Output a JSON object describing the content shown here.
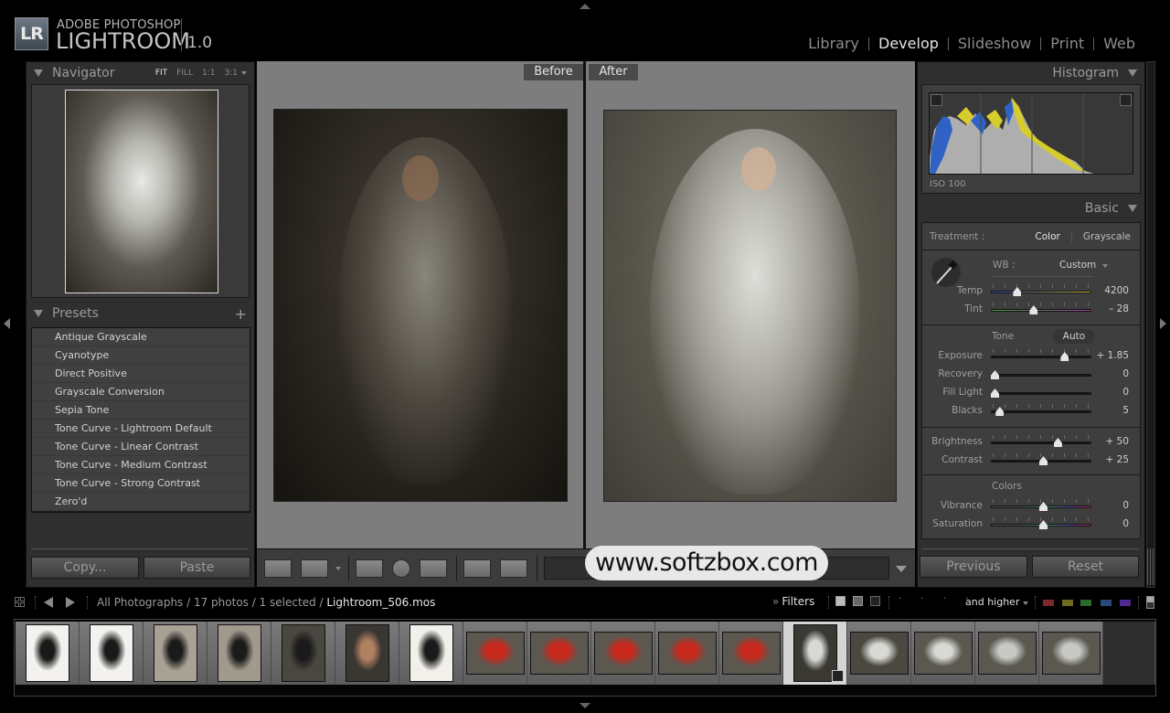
{
  "app": {
    "logo_badge": "LR",
    "vendor": "ADOBE PHOTOSHOP",
    "product": "LIGHTROOM",
    "version": "1.0"
  },
  "modules": [
    {
      "label": "Library",
      "active": false
    },
    {
      "label": "Develop",
      "active": true
    },
    {
      "label": "Slideshow",
      "active": false
    },
    {
      "label": "Print",
      "active": false
    },
    {
      "label": "Web",
      "active": false
    }
  ],
  "navigator": {
    "title": "Navigator",
    "zoom_options": [
      "FIT",
      "FILL",
      "1:1",
      "3:1"
    ],
    "zoom_selected": "FIT"
  },
  "presets": {
    "title": "Presets",
    "add_icon": "+",
    "items": [
      "Antique Grayscale",
      "Cyanotype",
      "Direct Positive",
      "Grayscale Conversion",
      "Sepia Tone",
      "Tone Curve - Lightroom Default",
      "Tone Curve - Linear Contrast",
      "Tone Curve - Medium Contrast",
      "Tone Curve - Strong Contrast",
      "Zero'd"
    ]
  },
  "left_buttons": {
    "copy": "Copy...",
    "paste": "Paste"
  },
  "view": {
    "before_label": "Before",
    "after_label": "After"
  },
  "toolbar": {
    "watermark": "www.softzbox.com",
    "icons": [
      "loupe-view-icon",
      "before-after-yy-icon",
      "crop-icon",
      "red-eye-icon",
      "spot-removal-icon",
      "copy-after-to-before-icon",
      "copy-before-to-after-icon"
    ]
  },
  "histogram": {
    "title": "Histogram",
    "iso": "ISO 100"
  },
  "basic": {
    "title": "Basic",
    "treatment_label": "Treatment :",
    "treatment_options": [
      "Color",
      "Grayscale"
    ],
    "treatment_selected": "Color",
    "wb_label": "WB :",
    "wb_value": "Custom",
    "wb_sliders": [
      {
        "label": "Temp",
        "value": "4200",
        "position": 0.23
      },
      {
        "label": "Tint",
        "value": "– 28",
        "position": 0.4
      }
    ],
    "tone_title": "Tone",
    "auto_label": "Auto",
    "tone_sliders": [
      {
        "label": "Exposure",
        "value": "+ 1.85",
        "position": 0.72
      },
      {
        "label": "Recovery",
        "value": "0",
        "position": 0.0
      },
      {
        "label": "Fill Light",
        "value": "0",
        "position": 0.0
      },
      {
        "label": "Blacks",
        "value": "5",
        "position": 0.05
      }
    ],
    "presence_sliders": [
      {
        "label": "Brightness",
        "value": "+ 50",
        "position": 0.65
      },
      {
        "label": "Contrast",
        "value": "+ 25",
        "position": 0.5
      }
    ],
    "colors_title": "Colors",
    "color_sliders": [
      {
        "label": "Vibrance",
        "value": "0",
        "position": 0.5
      },
      {
        "label": "Saturation",
        "value": "0",
        "position": 0.5
      }
    ]
  },
  "right_buttons": {
    "previous": "Previous",
    "reset": "Reset"
  },
  "filmstrip_bar": {
    "breadcrumb": "All Photographs / 17 photos / 1 selected / ",
    "filename": "Lightroom_506.mos",
    "filters_chevron": "»",
    "filters_label": "Filters",
    "rating_dots": "· · · · ·",
    "rating_filter": "and higher",
    "color_labels": [
      "#7a2a2a",
      "#6e6a1e",
      "#2a6a2a",
      "#2a4a7e",
      "#4e2a8e"
    ]
  },
  "filmstrip": {
    "count": 17,
    "selected_index": 12,
    "thumbnails": [
      {
        "orientation": "portrait",
        "tone": "#f4f2ee",
        "subject": "#1a1a1a"
      },
      {
        "orientation": "portrait",
        "tone": "#f4f2ee",
        "subject": "#1a1a1a"
      },
      {
        "orientation": "portrait",
        "tone": "#a8a294",
        "subject": "#1a1a1a"
      },
      {
        "orientation": "portrait",
        "tone": "#a09a8c",
        "subject": "#1a1a1a"
      },
      {
        "orientation": "portrait",
        "tone": "#4a4640",
        "subject": "#1a1a1a"
      },
      {
        "orientation": "portrait",
        "tone": "#3a3632",
        "subject": "#b08060"
      },
      {
        "orientation": "portrait",
        "tone": "#f2f0ea",
        "subject": "#1a1a1a"
      },
      {
        "orientation": "landscape",
        "tone": "#5c5850",
        "subject": "#c8281e"
      },
      {
        "orientation": "landscape",
        "tone": "#5c5850",
        "subject": "#c8281e"
      },
      {
        "orientation": "landscape",
        "tone": "#5c5850",
        "subject": "#c8281e"
      },
      {
        "orientation": "landscape",
        "tone": "#5c5850",
        "subject": "#c8281e"
      },
      {
        "orientation": "landscape",
        "tone": "#5c5850",
        "subject": "#c8281e"
      },
      {
        "orientation": "portrait",
        "tone": "#3a3832",
        "subject": "#d8d8d4"
      },
      {
        "orientation": "landscape",
        "tone": "#4a4840",
        "subject": "#d8d8d4"
      },
      {
        "orientation": "landscape",
        "tone": "#5a5850",
        "subject": "#d8d8d4"
      },
      {
        "orientation": "landscape",
        "tone": "#5a5850",
        "subject": "#c8c8c4"
      },
      {
        "orientation": "landscape",
        "tone": "#5a5850",
        "subject": "#c8c8c4"
      }
    ]
  }
}
